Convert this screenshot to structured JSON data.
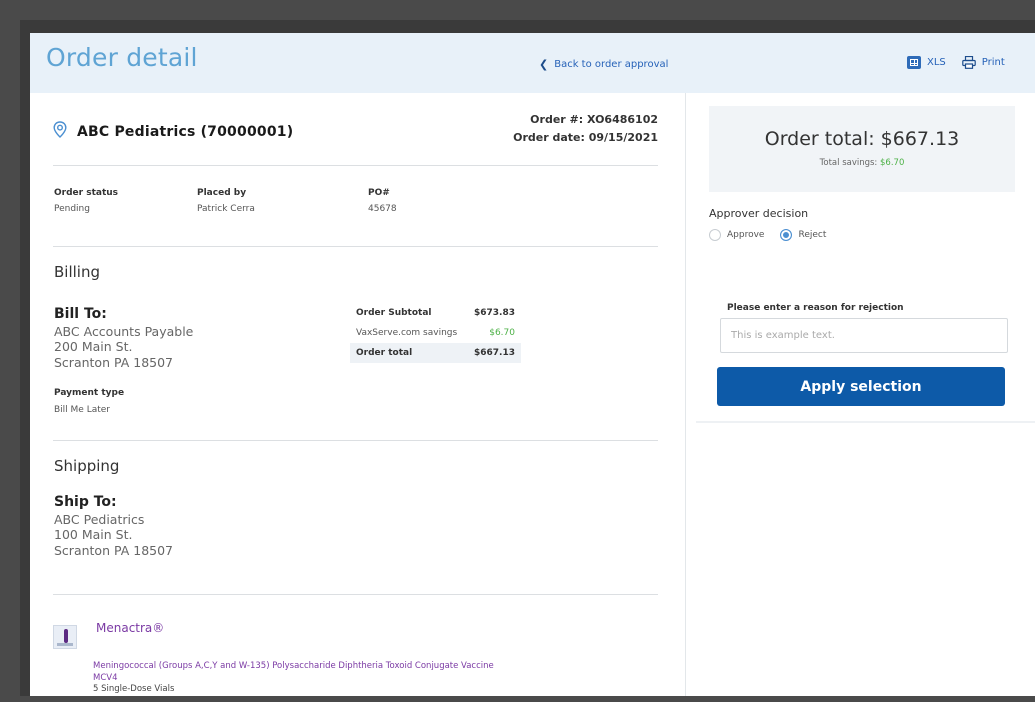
{
  "header": {
    "title": "Order detail",
    "back_link": "Back to order approval",
    "xls_label": "XLS",
    "print_label": "Print"
  },
  "customer": {
    "name": "ABC Pediatrics (70000001)"
  },
  "order": {
    "number_line": "Order #: XO6486102",
    "date_line": "Order date: 09/15/2021"
  },
  "meta": {
    "status_label": "Order status",
    "status_value": "Pending",
    "placed_by_label": "Placed by",
    "placed_by_value": "Patrick Cerra",
    "po_label": "PO#",
    "po_value": "45678"
  },
  "billing": {
    "section_title": "Billing",
    "bill_to_label": "Bill To:",
    "address": [
      "ABC Accounts Payable",
      "200 Main St.",
      "Scranton PA 18507"
    ],
    "payment_type_label": "Payment type",
    "payment_type_value": "Bill Me Later",
    "summary": [
      {
        "label": "Order Subtotal",
        "value": "$673.83"
      },
      {
        "label": "VaxServe.com savings",
        "value": "$6.70"
      },
      {
        "label": "Order total",
        "value": "$667.13"
      }
    ]
  },
  "shipping": {
    "section_title": "Shipping",
    "ship_to_label": "Ship To:",
    "address": [
      "ABC Pediatrics",
      "100 Main St.",
      "Scranton PA 18507"
    ]
  },
  "product": {
    "name": "Menactra®",
    "description_line1": "Meningococcal (Groups A,C,Y and W-135) Polysaccharide Diphtheria Toxoid Conjugate Vaccine",
    "description_line2": "MCV4",
    "pack": "5 Single-Dose Vials"
  },
  "summary_panel": {
    "total_line": "Order total: $667.13",
    "savings_label": "Total savings:",
    "savings_value": "$6.70",
    "decision_title": "Approver decision",
    "approve_label": "Approve",
    "reject_label": "Reject",
    "selected": "Reject",
    "reason_label": "Please enter a reason for rejection",
    "reason_placeholder": "This is example text.",
    "apply_label": "Apply selection"
  },
  "colors": {
    "brand_blue": "#0d5aa8",
    "title_blue": "#5fa4d4",
    "savings_green": "#4db147",
    "product_purple": "#7b3aa4"
  }
}
